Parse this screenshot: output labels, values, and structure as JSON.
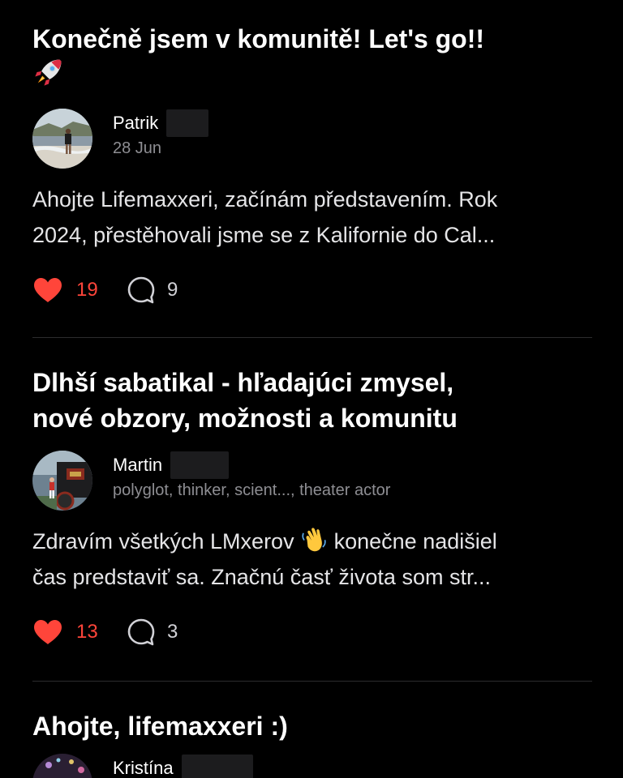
{
  "posts": [
    {
      "title": "Konečně jsem v komunitě! Let's go!!",
      "title_emoji": "rocket-emoji",
      "author_name": "Patrik",
      "author_sub": "28 Jun",
      "excerpt_line1": "Ahojte Lifemaxxeri, začínám představením. Rok",
      "excerpt_line2": "2024, přestěhovali jsme se z Kalifornie do Cal...",
      "likes": "19",
      "comments": "9"
    },
    {
      "title_line1": "Dlhší sabatikal - hľadajúci zmysel,",
      "title_line2": "nové obzory, možnosti a komunitu",
      "author_name": "Martin",
      "author_sub": "polyglot, thinker, scient..., theater actor",
      "excerpt_line1_a": "Zdravím všetkých LMxerov",
      "excerpt_emoji": "waving-hand-emoji",
      "excerpt_line1_b": "konečne nadišiel",
      "excerpt_line2": "čas predstaviť sa. Značnú časť života som str...",
      "likes": "13",
      "comments": "3"
    },
    {
      "title": "Ahojte, lifemaxxeri :)",
      "author_name": "Kristína"
    }
  ],
  "colors": {
    "background": "#000000",
    "like_accent": "#ff453a",
    "secondary_text": "#8e8e93",
    "divider": "#2c2c2e"
  }
}
